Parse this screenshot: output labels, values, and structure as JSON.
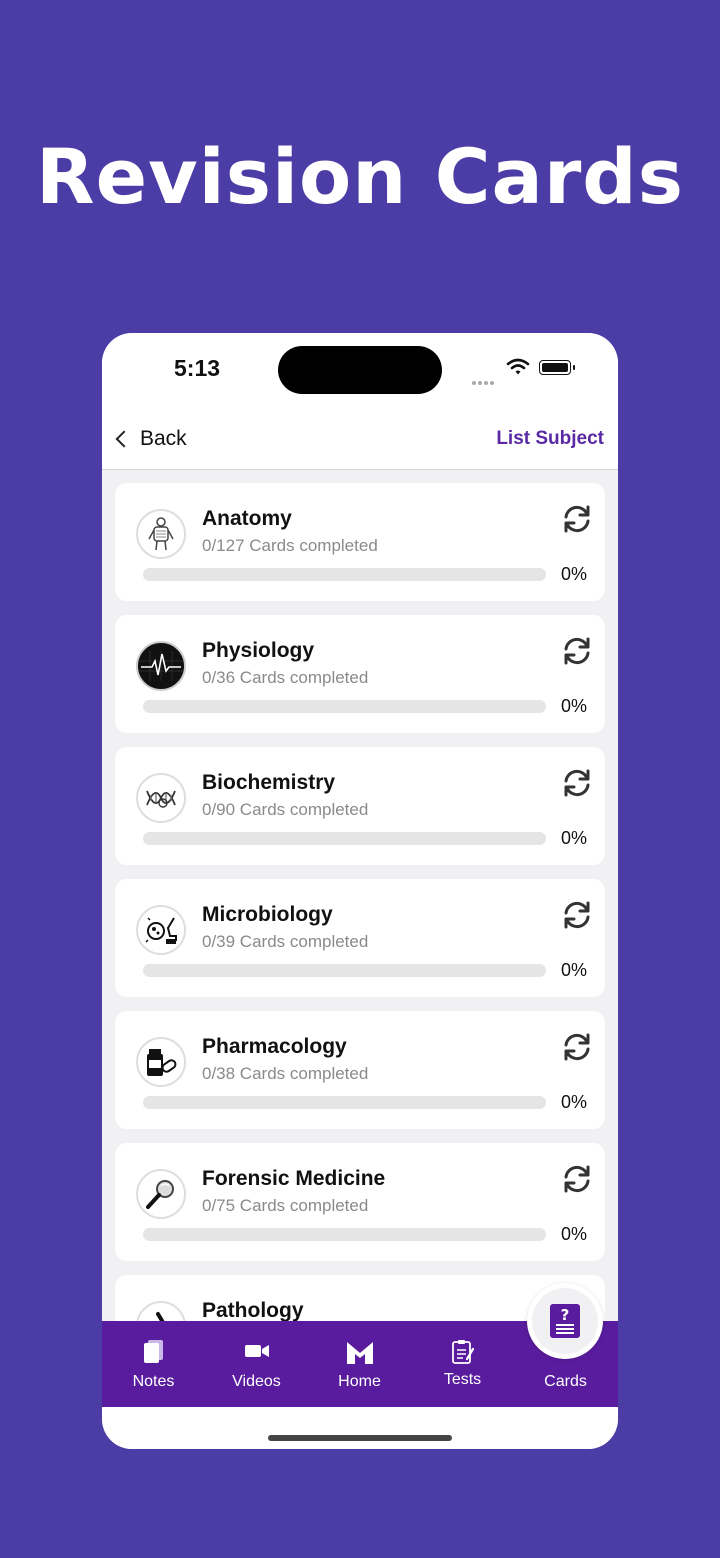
{
  "headline": "Revision Cards",
  "status": {
    "time": "5:13"
  },
  "nav": {
    "back_label": "Back",
    "right_label": "List Subject"
  },
  "subjects": [
    {
      "name": "Anatomy",
      "count": "0/127 Cards completed",
      "percent_label": "0%",
      "progress": 0,
      "icon": "anatomy-icon"
    },
    {
      "name": "Physiology",
      "count": "0/36 Cards completed",
      "percent_label": "0%",
      "progress": 0,
      "icon": "ecg-heartbeat-icon"
    },
    {
      "name": "Biochemistry",
      "count": "0/90 Cards completed",
      "percent_label": "0%",
      "progress": 0,
      "icon": "dna-icon"
    },
    {
      "name": "Microbiology",
      "count": "0/39 Cards completed",
      "percent_label": "0%",
      "progress": 0,
      "icon": "microscope-bacteria-icon"
    },
    {
      "name": "Pharmacology",
      "count": "0/38 Cards completed",
      "percent_label": "0%",
      "progress": 0,
      "icon": "pills-bottle-icon"
    },
    {
      "name": "Forensic Medicine",
      "count": "0/75 Cards completed",
      "percent_label": "0%",
      "progress": 0,
      "icon": "magnifier-icon"
    },
    {
      "name": "Pathology",
      "count": "",
      "percent_label": "",
      "progress": 0,
      "icon": "microscope-icon"
    }
  ],
  "tabs": [
    {
      "label": "Notes",
      "icon": "notes-icon"
    },
    {
      "label": "Videos",
      "icon": "video-camera-icon"
    },
    {
      "label": "Home",
      "icon": "home-logo-icon"
    },
    {
      "label": "Tests",
      "icon": "tests-clipboard-icon"
    },
    {
      "label": "Cards",
      "icon": "question-card-icon"
    }
  ],
  "colors": {
    "background": "#4B3DA5",
    "accent": "#5A2AA4",
    "tabbar": "#5A1C9E"
  }
}
